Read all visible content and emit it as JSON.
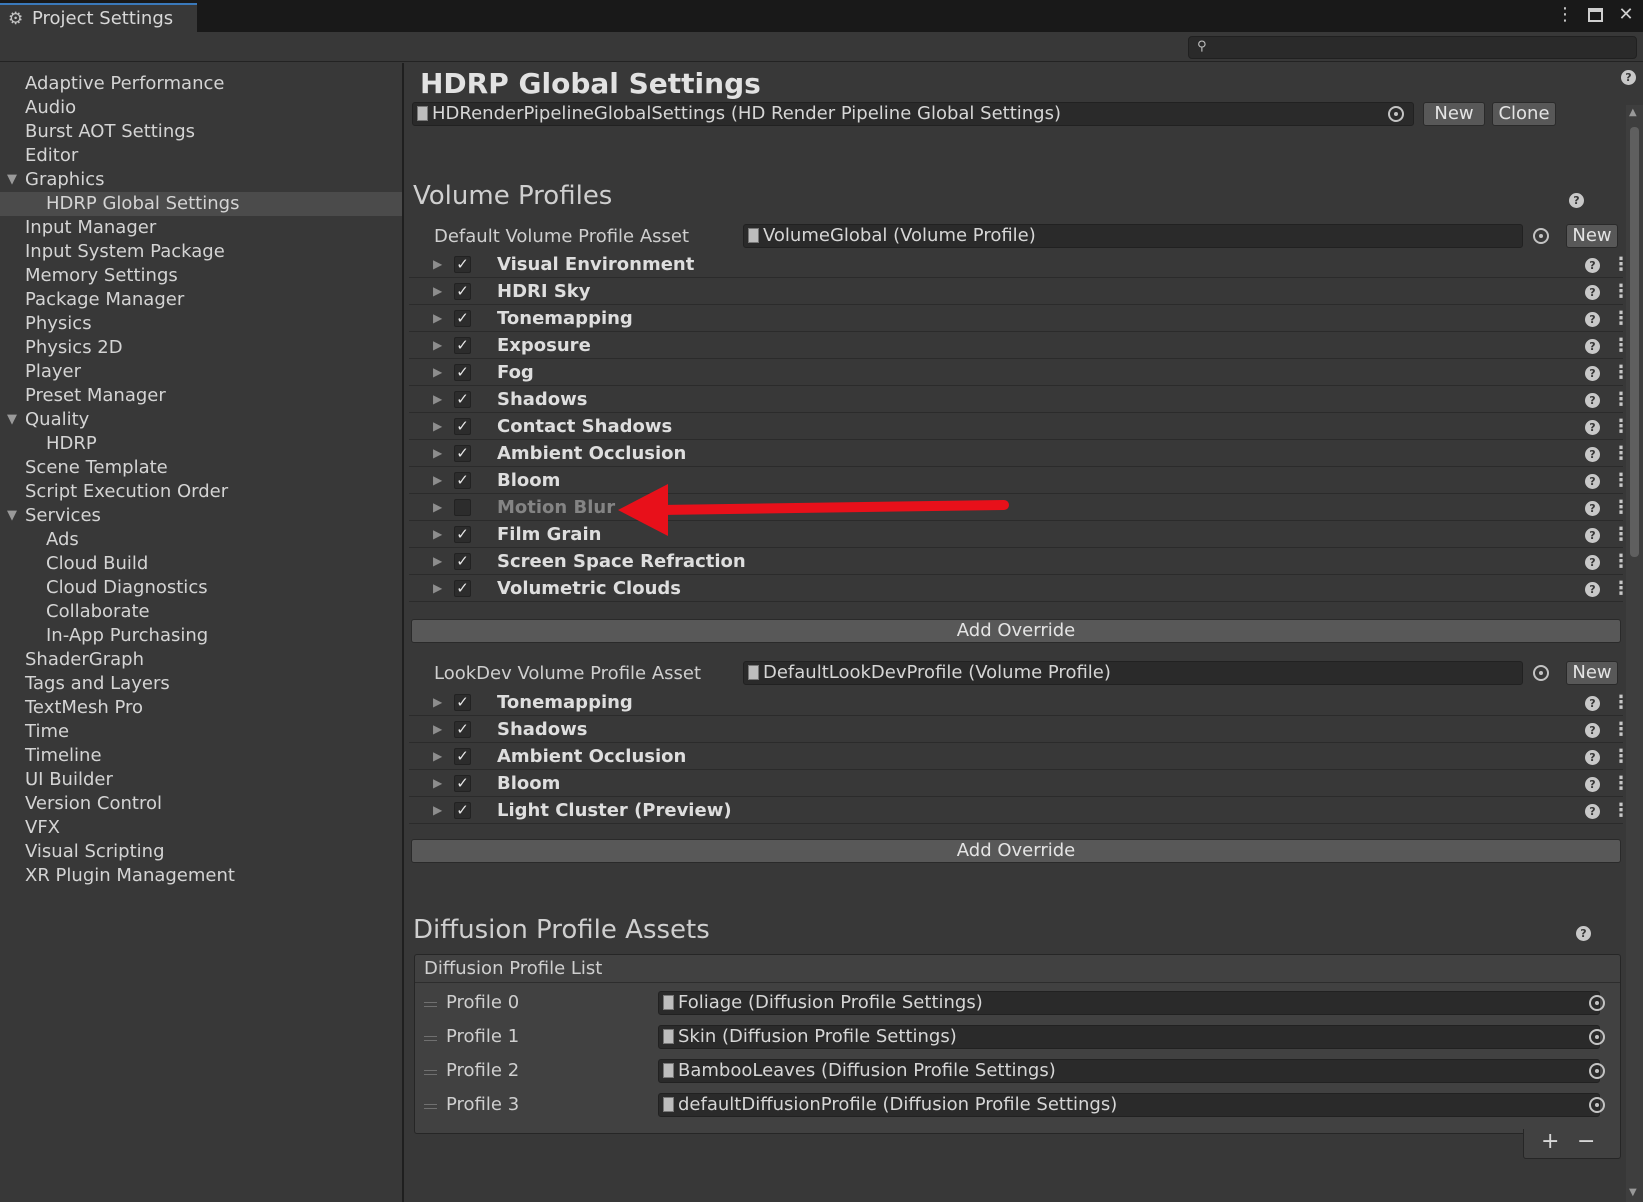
{
  "window": {
    "tab_title": "Project Settings",
    "icons": [
      "gear-icon",
      "kebab-icon",
      "maximize-icon",
      "close-icon"
    ],
    "kebab_glyph": "⋮",
    "close_glyph": "✕"
  },
  "search": {
    "icon": "search-icon",
    "placeholder": ""
  },
  "sidebar": {
    "items": [
      {
        "label": "Adaptive Performance",
        "indent": 0
      },
      {
        "label": "Audio",
        "indent": 0
      },
      {
        "label": "Burst AOT Settings",
        "indent": 0
      },
      {
        "label": "Editor",
        "indent": 0
      },
      {
        "label": "Graphics",
        "indent": 0,
        "expanded": true
      },
      {
        "label": "HDRP Global Settings",
        "indent": 1,
        "selected": true
      },
      {
        "label": "Input Manager",
        "indent": 0
      },
      {
        "label": "Input System Package",
        "indent": 0
      },
      {
        "label": "Memory Settings",
        "indent": 0
      },
      {
        "label": "Package Manager",
        "indent": 0
      },
      {
        "label": "Physics",
        "indent": 0
      },
      {
        "label": "Physics 2D",
        "indent": 0
      },
      {
        "label": "Player",
        "indent": 0
      },
      {
        "label": "Preset Manager",
        "indent": 0
      },
      {
        "label": "Quality",
        "indent": 0,
        "expanded": true
      },
      {
        "label": "HDRP",
        "indent": 1
      },
      {
        "label": "Scene Template",
        "indent": 0
      },
      {
        "label": "Script Execution Order",
        "indent": 0
      },
      {
        "label": "Services",
        "indent": 0,
        "expanded": true
      },
      {
        "label": "Ads",
        "indent": 1
      },
      {
        "label": "Cloud Build",
        "indent": 1
      },
      {
        "label": "Cloud Diagnostics",
        "indent": 1
      },
      {
        "label": "Collaborate",
        "indent": 1
      },
      {
        "label": "In-App Purchasing",
        "indent": 1
      },
      {
        "label": "ShaderGraph",
        "indent": 0
      },
      {
        "label": "Tags and Layers",
        "indent": 0
      },
      {
        "label": "TextMesh Pro",
        "indent": 0
      },
      {
        "label": "Time",
        "indent": 0
      },
      {
        "label": "Timeline",
        "indent": 0
      },
      {
        "label": "UI Builder",
        "indent": 0
      },
      {
        "label": "Version Control",
        "indent": 0
      },
      {
        "label": "VFX",
        "indent": 0
      },
      {
        "label": "Visual Scripting",
        "indent": 0
      },
      {
        "label": "XR Plugin Management",
        "indent": 0
      }
    ]
  },
  "main": {
    "title": "HDRP Global Settings",
    "asset_field": "HDRenderPipelineGlobalSettings (HD Render Pipeline Global Settings)",
    "new_label": "New",
    "clone_label": "Clone",
    "volume_profiles": {
      "heading": "Volume Profiles",
      "default_label": "Default Volume Profile Asset",
      "default_value": "VolumeGlobal (Volume Profile)",
      "default_new": "New",
      "default_overrides": [
        {
          "label": "Visual Environment",
          "enabled": true
        },
        {
          "label": "HDRI Sky",
          "enabled": true
        },
        {
          "label": "Tonemapping",
          "enabled": true
        },
        {
          "label": "Exposure",
          "enabled": true
        },
        {
          "label": "Fog",
          "enabled": true
        },
        {
          "label": "Shadows",
          "enabled": true
        },
        {
          "label": "Contact Shadows",
          "enabled": true
        },
        {
          "label": "Ambient Occlusion",
          "enabled": true
        },
        {
          "label": "Bloom",
          "enabled": true
        },
        {
          "label": "Motion Blur",
          "enabled": false
        },
        {
          "label": "Film Grain",
          "enabled": true
        },
        {
          "label": "Screen Space Refraction",
          "enabled": true
        },
        {
          "label": "Volumetric Clouds",
          "enabled": true
        }
      ],
      "add_override": "Add Override",
      "lookdev_label": "LookDev Volume Profile Asset",
      "lookdev_value": "DefaultLookDevProfile (Volume Profile)",
      "lookdev_new": "New",
      "lookdev_overrides": [
        {
          "label": "Tonemapping",
          "enabled": true
        },
        {
          "label": "Shadows",
          "enabled": true
        },
        {
          "label": "Ambient Occlusion",
          "enabled": true
        },
        {
          "label": "Bloom",
          "enabled": true
        },
        {
          "label": "Light Cluster (Preview)",
          "enabled": true
        }
      ],
      "lookdev_add_override": "Add Override"
    },
    "diffusion": {
      "heading": "Diffusion Profile Assets",
      "list_title": "Diffusion Profile List",
      "profiles": [
        {
          "label": "Profile 0",
          "value": "Foliage (Diffusion Profile Settings)"
        },
        {
          "label": "Profile 1",
          "value": "Skin (Diffusion Profile Settings)"
        },
        {
          "label": "Profile 2",
          "value": "BambooLeaves (Diffusion Profile Settings)"
        },
        {
          "label": "Profile 3",
          "value": "defaultDiffusionProfile (Diffusion Profile Settings)"
        }
      ],
      "plus": "+",
      "minus": "−"
    },
    "help_glyph": "?",
    "check_glyph": "✓",
    "fold_glyph": "▶",
    "annotation": {
      "type": "red-arrow",
      "points_to": "Motion Blur",
      "color": "#e8101a"
    }
  }
}
